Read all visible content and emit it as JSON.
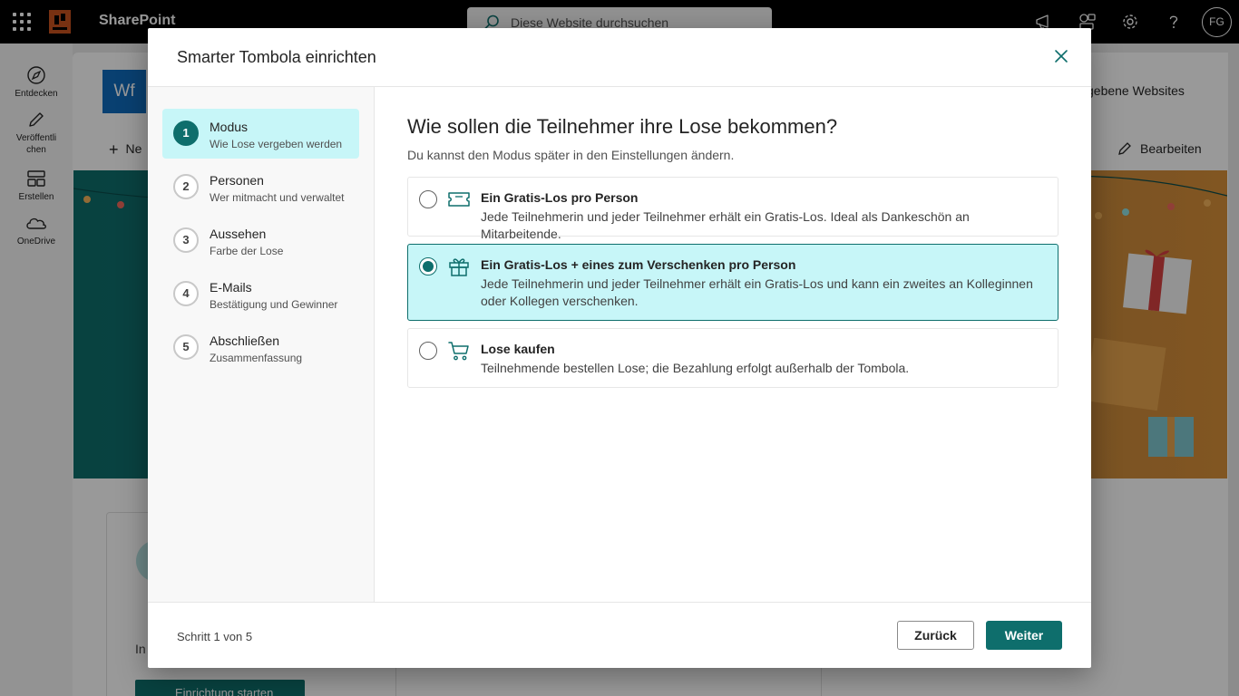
{
  "suitebar": {
    "app_name": "SharePoint",
    "search_placeholder": "Diese Website durchsuchen",
    "avatar_initials": "FG"
  },
  "appbar": {
    "items": [
      {
        "label": "Entdecken",
        "icon": "compass-icon"
      },
      {
        "label": "Veröffentli chen",
        "icon": "pen-icon"
      },
      {
        "label": "Erstellen",
        "icon": "layout-icon"
      },
      {
        "label": "OneDrive",
        "icon": "cloud-icon"
      }
    ]
  },
  "background_page": {
    "site_tile": "Wf",
    "new_label": "Ne",
    "shared_sites": "gebene Websites",
    "edit_label": "Bearbeiten",
    "card_text": "In",
    "start_button": "Einrichtung starten"
  },
  "dialog": {
    "title": "Smarter Tombola einrichten",
    "steps": [
      {
        "number": "1",
        "label": "Modus",
        "sub": "Wie Lose vergeben werden",
        "active": true
      },
      {
        "number": "2",
        "label": "Personen",
        "sub": "Wer mitmacht und verwaltet",
        "active": false
      },
      {
        "number": "3",
        "label": "Aussehen",
        "sub": "Farbe der Lose",
        "active": false
      },
      {
        "number": "4",
        "label": "E-Mails",
        "sub": "Bestätigung und Gewinner",
        "active": false
      },
      {
        "number": "5",
        "label": "Abschließen",
        "sub": "Zusammenfassung",
        "active": false
      }
    ],
    "question": "Wie sollen die Teilnehmer ihre Lose bekommen?",
    "question_sub": "Du kannst den Modus später in den Einstellungen ändern.",
    "options": [
      {
        "title": "Ein Gratis-Los pro Person",
        "desc": "Jede Teilnehmerin und jeder Teilnehmer erhält ein Gratis-Los. Ideal als Dankeschön an Mitarbeitende.",
        "icon": "ticket-icon",
        "selected": false
      },
      {
        "title": "Ein Gratis-Los + eines zum Verschenken pro Person",
        "desc": "Jede Teilnehmerin und jeder Teilnehmer erhält ein Gratis-Los und kann ein zweites an Kolleginnen oder Kollegen verschenken.",
        "icon": "gift-icon",
        "selected": true
      },
      {
        "title": "Lose kaufen",
        "desc": "Teilnehmende bestellen Lose; die Bezahlung erfolgt außerhalb der Tombola.",
        "icon": "cart-icon",
        "selected": false
      }
    ],
    "step_counter": "Schritt 1 von 5",
    "back_label": "Zurück",
    "next_label": "Weiter"
  },
  "colors": {
    "accent": "#0e6e6c",
    "selected_bg": "#c7f6f8",
    "suitebar": "#000000"
  }
}
